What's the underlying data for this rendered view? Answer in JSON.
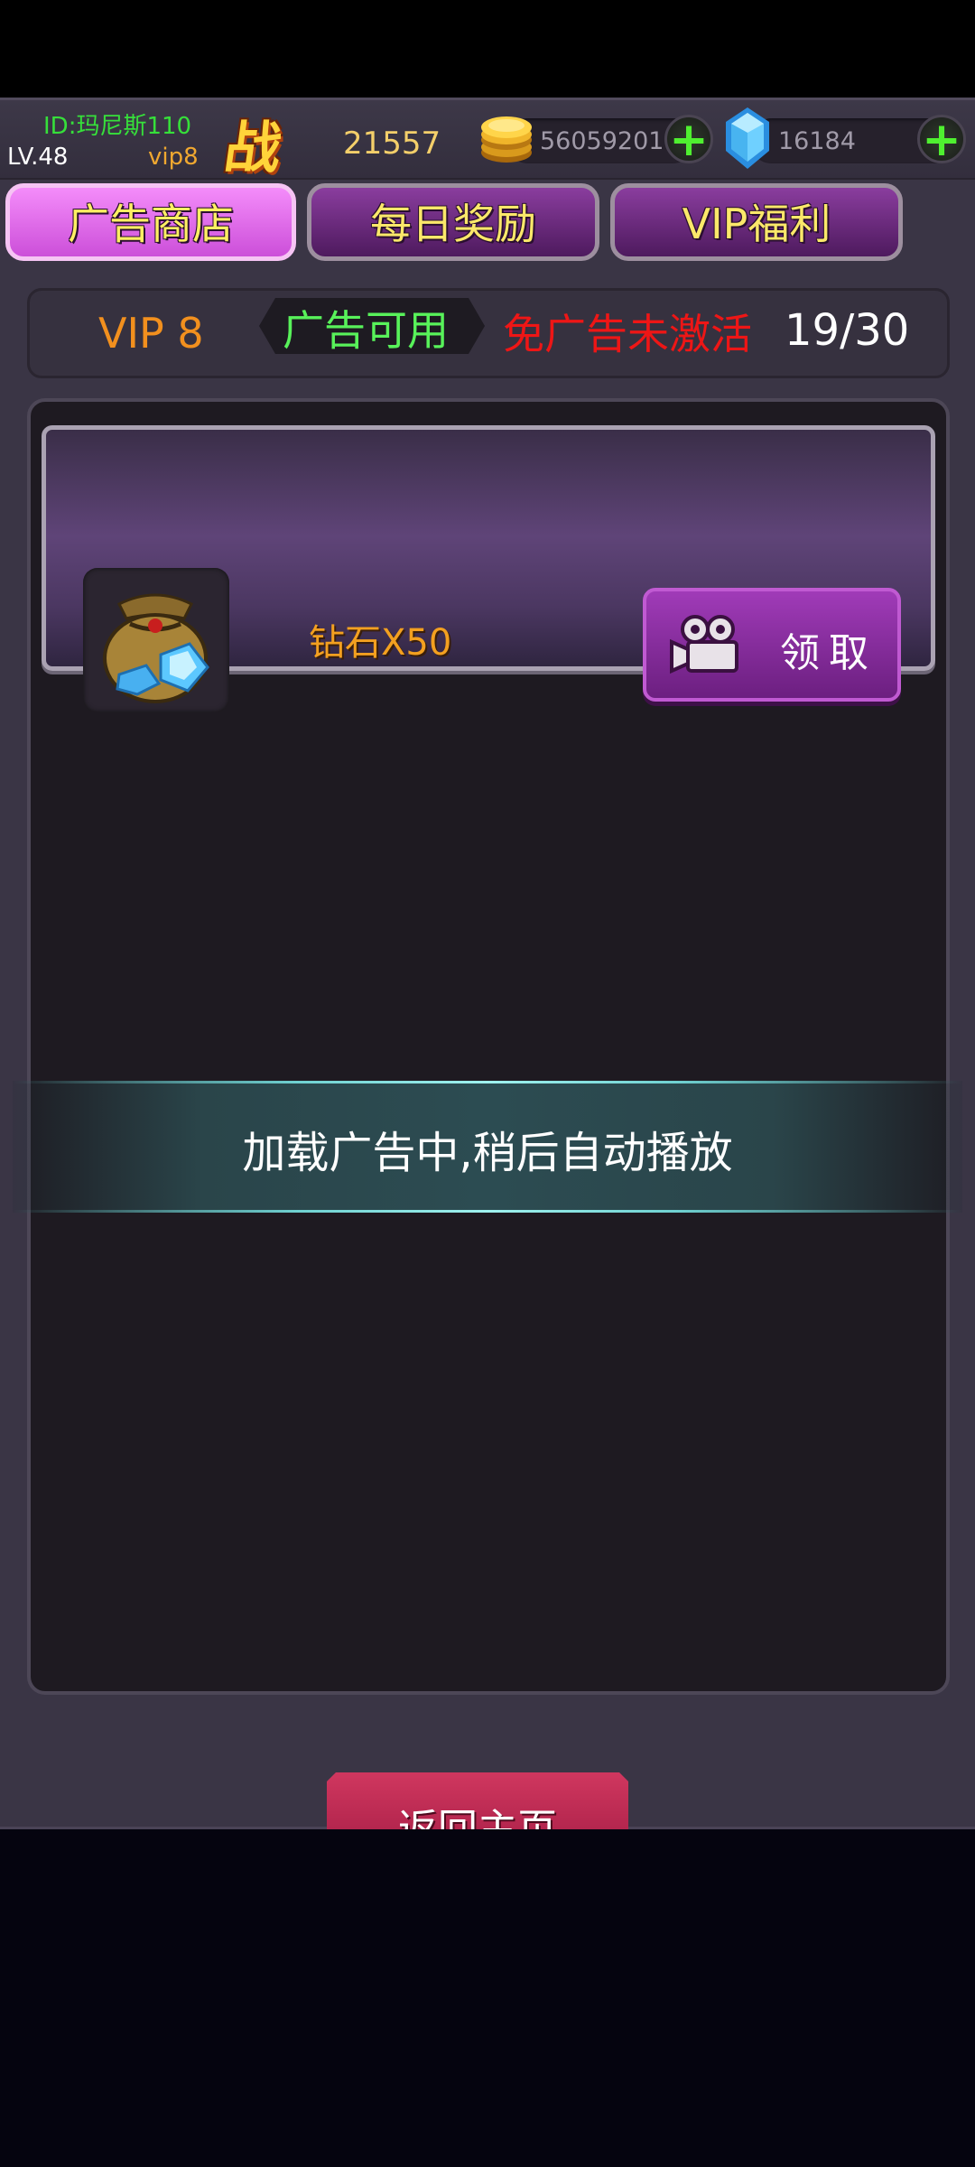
{
  "player": {
    "id": "ID:玛尼斯110",
    "level": "LV.48",
    "vip": "vip8",
    "power_icon": "战",
    "power": "21557"
  },
  "resources": {
    "gold": "56059201",
    "gems": "16184",
    "add_symbol": "+"
  },
  "tabs": [
    {
      "label": "广告商店",
      "active": true
    },
    {
      "label": "每日奖励",
      "active": false
    },
    {
      "label": "VIP福利",
      "active": false
    }
  ],
  "status": {
    "vip_level": "VIP 8",
    "ad_available": "广告可用",
    "ad_free": "免广告未激活",
    "ad_count": "19/30"
  },
  "rewards": [
    {
      "name": "钻石X50",
      "button": "领取",
      "icon": "diamond-bag-icon"
    }
  ],
  "toast": "加载广告中,稍后自动播放",
  "home_button": "返回主页",
  "colors": {
    "accent_gold": "#f3a020",
    "ad_available_green": "#58f25a",
    "ad_free_red": "#ee1616",
    "tab_active": "#cc4fd9",
    "home_button": "#c02a52"
  }
}
